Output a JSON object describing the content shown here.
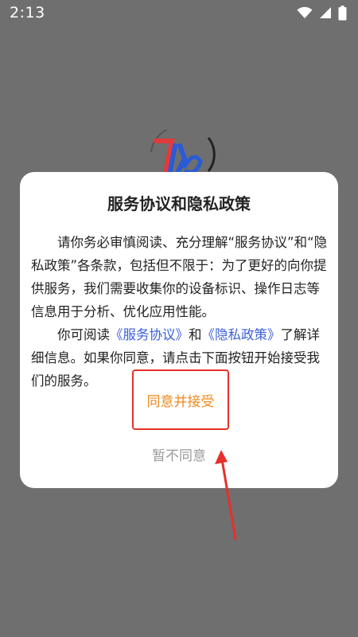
{
  "status_bar": {
    "time": "2:13",
    "icons": [
      "wifi-icon",
      "signal-icon",
      "battery-icon"
    ]
  },
  "splash": {
    "logo_icon": "app-logo-icon"
  },
  "dialog": {
    "title": "服务协议和隐私政策",
    "paragraph1": "请你务必审慎阅读、充分理解“服务协议”和“隐私政策”各条款，包括但不限于：为了更好的向你提供服务，我们需要收集你的设备标识、操作日志等信息用于分析、优化应用性能。",
    "paragraph2_prefix": "你可阅读",
    "service_link": "《服务协议》",
    "paragraph2_and": "和",
    "privacy_link": "《隐私政策》",
    "paragraph2_suffix": "了解详细信息。如果你同意，请点击下面按钮开始接受我们的服务。",
    "accept_label": "同意并接受",
    "decline_label": "暂不同意"
  },
  "colors": {
    "overlay": "#6f6f6f",
    "link": "#3a5ed8",
    "accept_text": "#ee8a1e",
    "highlight_box": "#e8302a",
    "decline_text": "#9a9a9a"
  }
}
